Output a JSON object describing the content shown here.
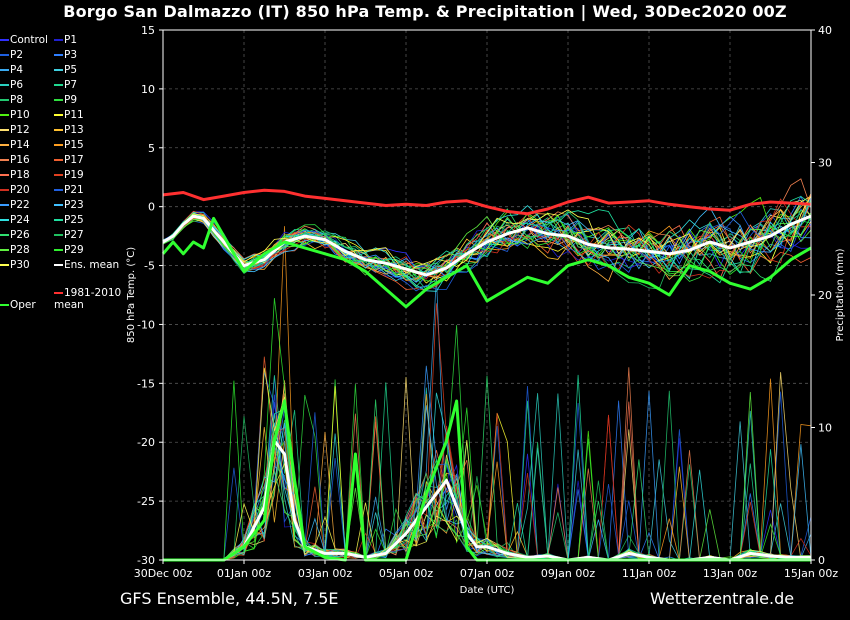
{
  "header": {
    "title": "Borgo San Dalmazzo  (IT)  850 hPa Temp. & Precipitation | Wed, 30Dec2020 00Z"
  },
  "footer": {
    "model_info": "GFS Ensemble, 44.5N, 7.5E",
    "site": "Wetterzentrale.de"
  },
  "chart_data": {
    "type": "line",
    "xlabel": "Date (UTC)",
    "ylabel": "850 hPa Temp. (°C)",
    "y2label": "Precipitation (mm)",
    "x_ticks": [
      "30Dec 00z",
      "01Jan 00z",
      "03Jan 00z",
      "05Jan 00z",
      "07Jan 00z",
      "09Jan 00z",
      "11Jan 00z",
      "13Jan 00z",
      "15Jan 00z"
    ],
    "x_range_hours": [
      0,
      384
    ],
    "ylim": [
      -30,
      15
    ],
    "y_ticks": [
      15,
      10,
      5,
      0,
      -5,
      -10,
      -15,
      -20,
      -25,
      -30
    ],
    "y2lim": [
      0,
      40
    ],
    "y2_ticks": [
      40,
      30,
      20,
      10,
      0
    ],
    "grid": true,
    "legend_placement": "left outside",
    "legend": [
      {
        "name": "Control",
        "color": "#3030ff"
      },
      {
        "name": "P1",
        "color": "#2020d0"
      },
      {
        "name": "P2",
        "color": "#1e5fe0"
      },
      {
        "name": "P3",
        "color": "#2f7fff"
      },
      {
        "name": "P4",
        "color": "#3aaaf0"
      },
      {
        "name": "P5",
        "color": "#40d0e0"
      },
      {
        "name": "P6",
        "color": "#2ad0c0"
      },
      {
        "name": "P7",
        "color": "#20d890"
      },
      {
        "name": "P8",
        "color": "#22c870"
      },
      {
        "name": "P9",
        "color": "#30e040"
      },
      {
        "name": "P10",
        "color": "#50f010"
      },
      {
        "name": "P11",
        "color": "#ffff30"
      },
      {
        "name": "P12",
        "color": "#ffe070"
      },
      {
        "name": "P13",
        "color": "#ffc030"
      },
      {
        "name": "P14",
        "color": "#ffb040"
      },
      {
        "name": "P15",
        "color": "#ff9e20"
      },
      {
        "name": "P16",
        "color": "#f08050"
      },
      {
        "name": "P17",
        "color": "#f06030"
      },
      {
        "name": "P18",
        "color": "#ff7050"
      },
      {
        "name": "P19",
        "color": "#e04020"
      },
      {
        "name": "P20",
        "color": "#d03020"
      },
      {
        "name": "P21",
        "color": "#2060e0"
      },
      {
        "name": "P22",
        "color": "#3a9cff"
      },
      {
        "name": "P23",
        "color": "#40c0ff"
      },
      {
        "name": "P24",
        "color": "#30e0e0"
      },
      {
        "name": "P25",
        "color": "#20e0a0"
      },
      {
        "name": "P26",
        "color": "#30e070"
      },
      {
        "name": "P27",
        "color": "#20c060"
      },
      {
        "name": "P28",
        "color": "#60f040"
      },
      {
        "name": "P29",
        "color": "#30f030"
      },
      {
        "name": "P30",
        "color": "#ffff50"
      },
      {
        "name": "Ens. mean",
        "color": "#ffffff"
      },
      {
        "name": "Oper",
        "color": "#30ff30"
      },
      {
        "name": "1981-2010\nmean",
        "color": "#ff3030"
      }
    ],
    "series": [
      {
        "name": "1981-2010\nmean",
        "axis": "temp",
        "color": "#ff3030",
        "x": [
          0,
          12,
          24,
          36,
          48,
          60,
          72,
          84,
          96,
          108,
          120,
          132,
          144,
          156,
          168,
          180,
          192,
          204,
          216,
          228,
          240,
          252,
          264,
          276,
          288,
          300,
          312,
          324,
          336,
          348,
          360,
          372,
          384
        ],
        "values": [
          1,
          1.2,
          0.6,
          0.9,
          1.2,
          1.4,
          1.3,
          0.9,
          0.7,
          0.5,
          0.3,
          0.1,
          0.2,
          0.1,
          0.4,
          0.5,
          0,
          -0.4,
          -0.6,
          -0.2,
          0.4,
          0.8,
          0.3,
          0.4,
          0.5,
          0.2,
          0,
          -0.2,
          -0.3,
          0.2,
          0.4,
          0.3,
          0.2
        ]
      },
      {
        "name": "Ens. mean",
        "axis": "temp",
        "color": "#ffffff",
        "x": [
          0,
          6,
          12,
          18,
          24,
          30,
          36,
          48,
          60,
          72,
          84,
          96,
          108,
          120,
          132,
          144,
          156,
          168,
          180,
          192,
          204,
          216,
          228,
          240,
          252,
          264,
          276,
          288,
          300,
          312,
          324,
          336,
          348,
          360,
          372,
          384
        ],
        "values": [
          -3,
          -2.5,
          -1.5,
          -0.8,
          -1,
          -2,
          -3,
          -5,
          -4.5,
          -3,
          -2.5,
          -2.8,
          -3.8,
          -4.5,
          -4.8,
          -5.3,
          -5.8,
          -5.2,
          -4,
          -3,
          -2.3,
          -1.8,
          -2.3,
          -2.5,
          -3.2,
          -3.5,
          -3.6,
          -3.8,
          -4,
          -3.7,
          -3,
          -3.5,
          -3,
          -2.5,
          -1.5,
          -0.8
        ]
      },
      {
        "name": "Oper",
        "axis": "temp",
        "color": "#30ff30",
        "x": [
          0,
          6,
          12,
          18,
          24,
          30,
          36,
          48,
          60,
          72,
          84,
          96,
          108,
          120,
          132,
          144,
          156,
          168,
          180,
          192,
          204,
          216,
          228,
          240,
          252,
          264,
          276,
          288,
          300,
          312,
          324,
          336,
          348,
          360,
          372,
          384
        ],
        "values": [
          -4,
          -3,
          -4,
          -3,
          -3.5,
          -1,
          -2.5,
          -5.5,
          -4,
          -3,
          -3.5,
          -4,
          -4.5,
          -5.5,
          -7,
          -8.5,
          -7,
          -6,
          -5,
          -8,
          -7,
          -6,
          -6.5,
          -5,
          -4.5,
          -5,
          -6,
          -6.5,
          -7.5,
          -5,
          -5.5,
          -6.5,
          -7,
          -6,
          -4.5,
          -3.5
        ]
      },
      {
        "name": "Ens. mean precipitation",
        "axis": "precip",
        "color": "#ffffff",
        "x": [
          0,
          24,
          36,
          48,
          60,
          66,
          72,
          78,
          84,
          96,
          108,
          120,
          132,
          144,
          156,
          168,
          180,
          186,
          192,
          204,
          216,
          228,
          240,
          252,
          264,
          276,
          288,
          300,
          312,
          324,
          336,
          348,
          360,
          372,
          384
        ],
        "values": [
          0,
          0,
          0,
          1,
          4,
          9,
          8,
          3,
          1,
          0.5,
          0.5,
          0.2,
          0.5,
          2,
          4,
          6,
          2,
          1,
          1,
          0.5,
          0.2,
          0.3,
          0,
          0.2,
          0,
          0.5,
          0.2,
          0,
          0,
          0.2,
          0,
          0.5,
          0.3,
          0.2,
          0.2
        ]
      },
      {
        "name": "Oper precipitation",
        "axis": "precip",
        "color": "#30ff30",
        "x": [
          0,
          24,
          36,
          48,
          60,
          66,
          72,
          78,
          84,
          96,
          108,
          114,
          120,
          132,
          144,
          156,
          168,
          174,
          180,
          186,
          192,
          204,
          216,
          228,
          240,
          252,
          264,
          276,
          288,
          300,
          312,
          324,
          336,
          348,
          360,
          372,
          384
        ],
        "values": [
          0,
          0,
          0,
          1,
          3,
          9,
          12,
          6,
          1,
          0.2,
          0,
          8,
          0,
          0,
          0,
          5,
          9,
          12,
          1,
          0,
          0,
          0,
          0,
          0,
          0,
          0,
          0,
          0,
          0,
          0,
          0,
          0,
          0,
          0,
          0,
          0,
          0
        ]
      }
    ]
  }
}
